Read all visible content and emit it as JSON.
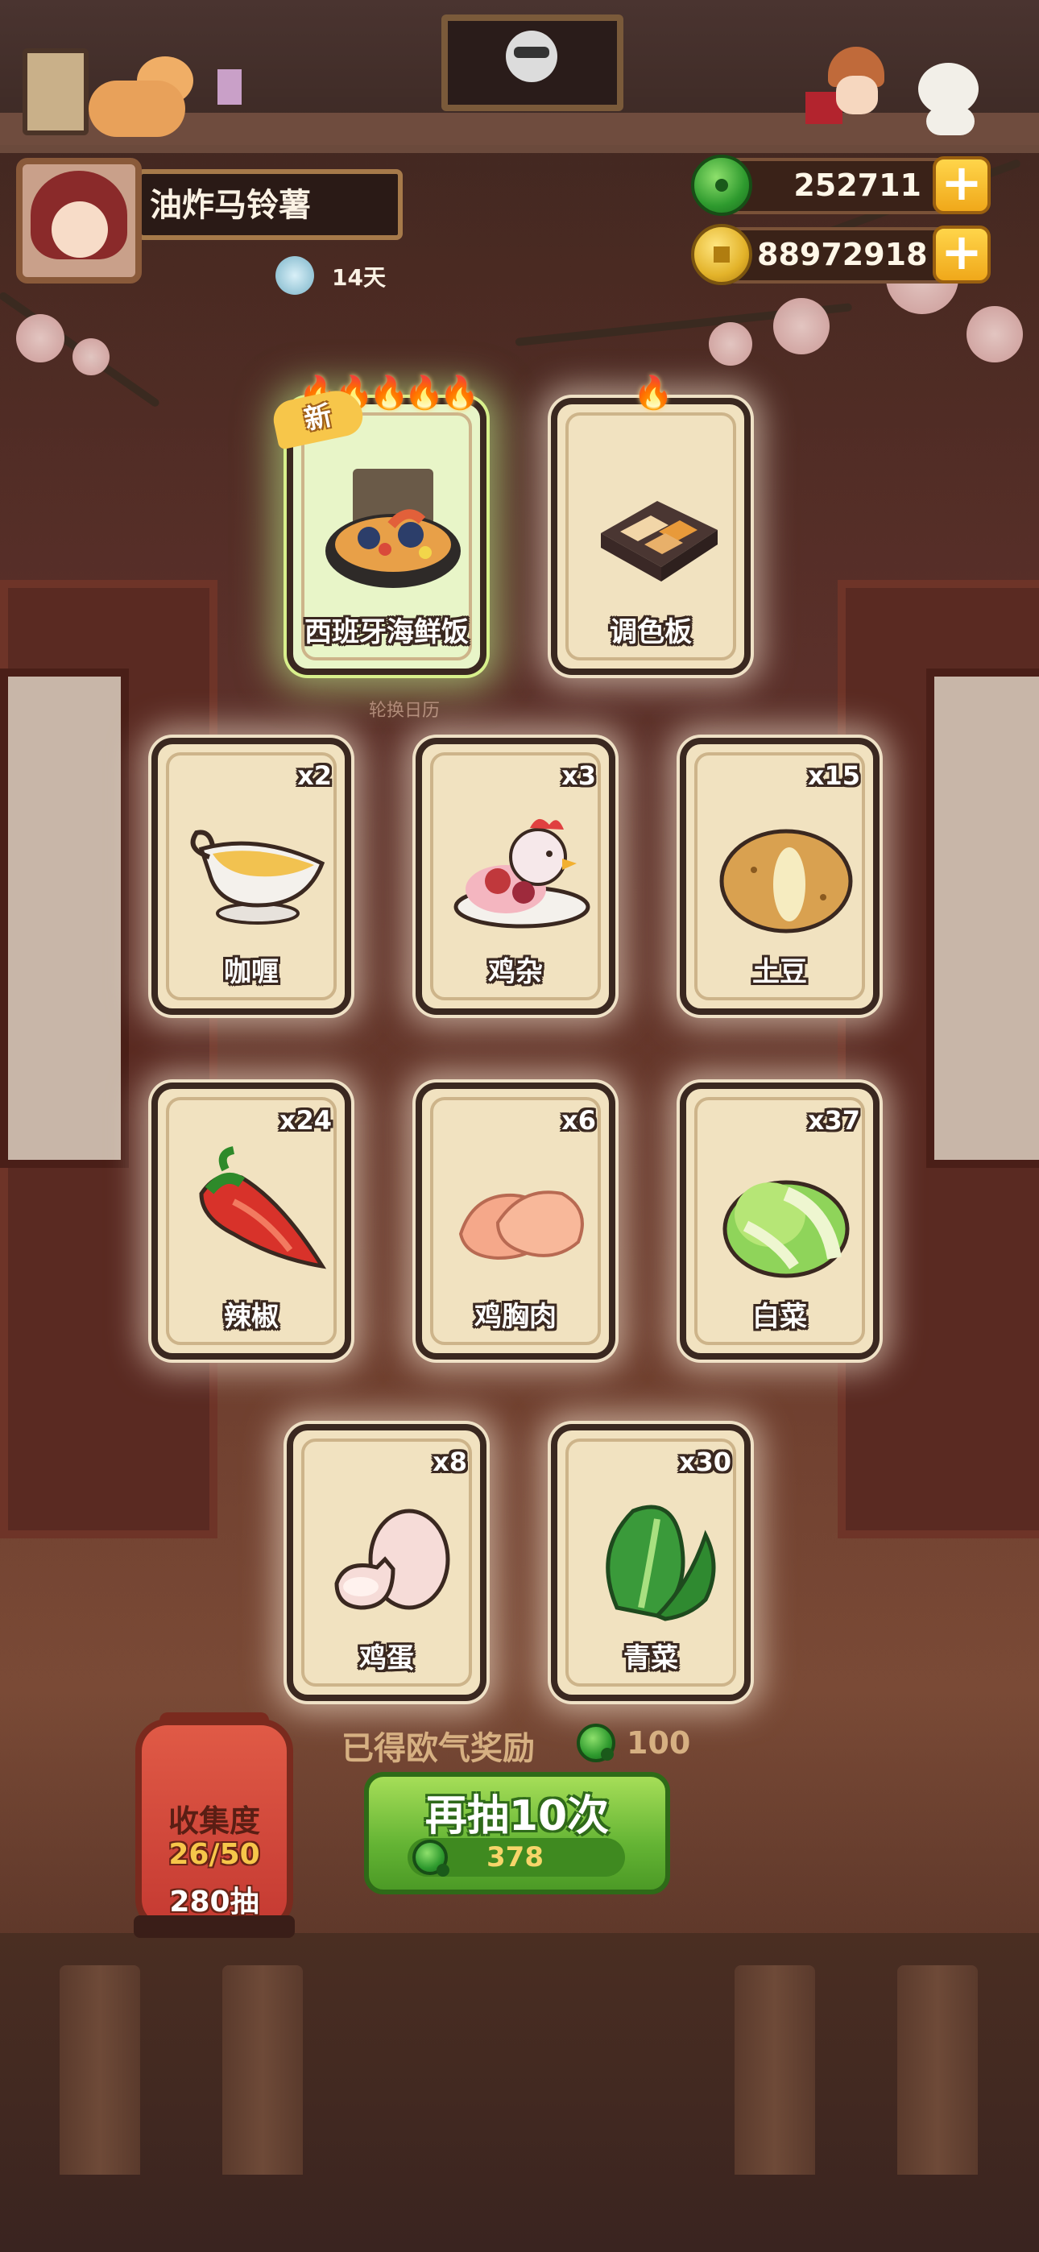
{
  "player": {
    "name": "油炸马铃薯",
    "days": "14天"
  },
  "currency": {
    "jade": "252711",
    "coins": "88972918"
  },
  "colors": {
    "accent_green": "#64b434",
    "gold": "#f0a81a",
    "card_bg": "#f1e2c0",
    "lantern_red": "#c53a32"
  },
  "calendar_label": "轮换日历",
  "cards": [
    {
      "name": "西班牙海鲜饭",
      "qty": "",
      "flames": 5,
      "is_new": true,
      "new_label": "新",
      "icon": "seafood-paella-icon"
    },
    {
      "name": "调色板",
      "qty": "",
      "flames": 1,
      "is_new": false,
      "icon": "palette-icon"
    },
    {
      "name": "咖喱",
      "qty": "x2",
      "icon": "curry-gravy-boat-icon"
    },
    {
      "name": "鸡杂",
      "qty": "x3",
      "icon": "chicken-giblets-icon"
    },
    {
      "name": "土豆",
      "qty": "x15",
      "icon": "potato-icon"
    },
    {
      "name": "辣椒",
      "qty": "x24",
      "icon": "chili-pepper-icon"
    },
    {
      "name": "鸡胸肉",
      "qty": "x6",
      "icon": "chicken-breast-icon"
    },
    {
      "name": "白菜",
      "qty": "x37",
      "icon": "napa-cabbage-icon"
    },
    {
      "name": "鸡蛋",
      "qty": "x8",
      "icon": "egg-icon"
    },
    {
      "name": "青菜",
      "qty": "x30",
      "icon": "bok-choy-icon"
    }
  ],
  "reward": {
    "label": "已得欧气奖励",
    "value": "100"
  },
  "draw_button": {
    "label": "再抽10次",
    "cost": "378"
  },
  "collection": {
    "title": "收集度",
    "progress": "26/50",
    "draws": "280抽"
  }
}
